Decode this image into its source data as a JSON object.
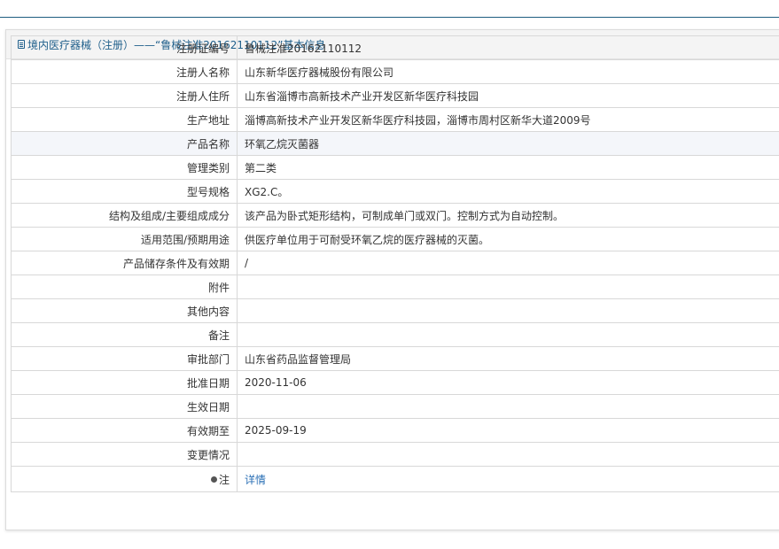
{
  "header": {
    "title": "境内医疗器械（注册）——“鲁械注准20162110112”基本信息",
    "icon": "document-icon"
  },
  "rows": [
    {
      "label": "注册证编号",
      "value": "鲁械注准20162110112"
    },
    {
      "label": "注册人名称",
      "value": "山东新华医疗器械股份有限公司"
    },
    {
      "label": "注册人住所",
      "value": "山东省淄博市高新技术产业开发区新华医疗科技园"
    },
    {
      "label": "生产地址",
      "value": "淄博高新技术产业开发区新华医疗科技园，淄博市周村区新华大道2009号"
    },
    {
      "label": "产品名称",
      "value": "环氧乙烷灭菌器"
    },
    {
      "label": "管理类别",
      "value": "第二类"
    },
    {
      "label": "型号规格",
      "value": "XG2.C。"
    },
    {
      "label": "结构及组成/主要组成成分",
      "value": "该产品为卧式矩形结构，可制成单门或双门。控制方式为自动控制。"
    },
    {
      "label": "适用范围/预期用途",
      "value": "供医疗单位用于可耐受环氧乙烷的医疗器械的灭菌。"
    },
    {
      "label": "产品储存条件及有效期",
      "value": "/"
    },
    {
      "label": "附件",
      "value": ""
    },
    {
      "label": "其他内容",
      "value": ""
    },
    {
      "label": "备注",
      "value": ""
    },
    {
      "label": "审批部门",
      "value": "山东省药品监督管理局"
    },
    {
      "label": "批准日期",
      "value": "2020-11-06"
    },
    {
      "label": "生效日期",
      "value": ""
    },
    {
      "label": "有效期至",
      "value": "2025-09-19"
    },
    {
      "label": "变更情况",
      "value": ""
    }
  ],
  "note": {
    "icon": "lightbulb-icon",
    "label": "注",
    "link_text": "详情"
  },
  "colors": {
    "accent": "#1f5f8b",
    "link": "#2a6fb5",
    "highlight_row": "#f4f6fa"
  }
}
